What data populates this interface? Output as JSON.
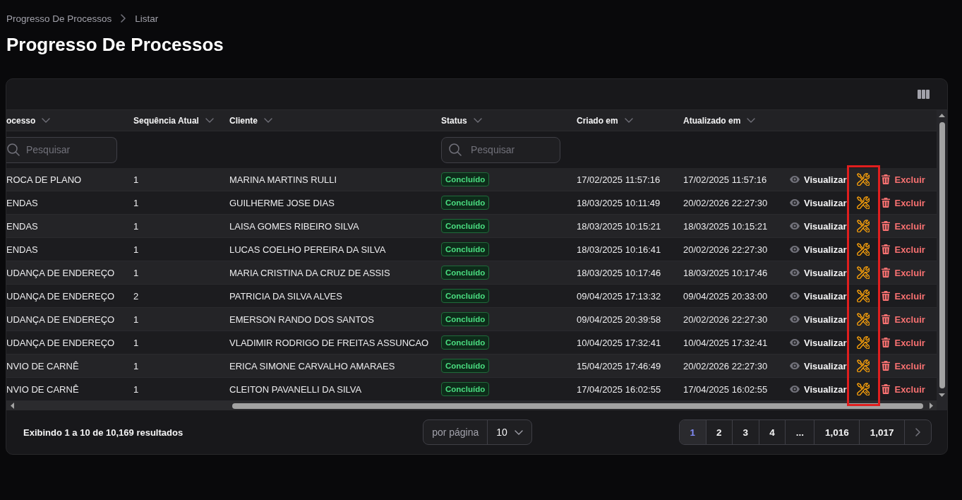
{
  "breadcrumb": [
    {
      "label": "Progresso De Processos"
    },
    {
      "label": "Listar"
    }
  ],
  "page_title": "Progresso De Processos",
  "table": {
    "columns": [
      {
        "label": "ocesso",
        "kind": "text",
        "filter": {
          "placeholder": "Pesquisar"
        }
      },
      {
        "label": "Sequência Atual",
        "kind": "text"
      },
      {
        "label": "Cliente",
        "kind": "text"
      },
      {
        "label": "Status",
        "kind": "badge",
        "filter": {
          "placeholder": "Pesquisar"
        }
      },
      {
        "label": "Criado em",
        "kind": "text"
      },
      {
        "label": "Atualizado em",
        "kind": "text"
      }
    ],
    "rows": [
      {
        "cells": [
          "ROCA DE PLANO",
          "1",
          "MARINA MARTINS RULLI",
          "Concluído",
          "17/02/2025 11:57:16",
          "17/02/2025 11:57:16"
        ],
        "actions": [
          {
            "kind": "view",
            "label": "Visualizar"
          },
          {
            "kind": "edit"
          },
          {
            "kind": "delete",
            "label": "Excluir"
          }
        ]
      },
      {
        "cells": [
          "ENDAS",
          "1",
          "GUILHERME JOSE DIAS",
          "Concluído",
          "18/03/2025 10:11:49",
          "20/02/2026 22:27:30"
        ],
        "actions": [
          {
            "kind": "view",
            "label": "Visualizar"
          },
          {
            "kind": "edit"
          },
          {
            "kind": "delete",
            "label": "Excluir"
          }
        ]
      },
      {
        "cells": [
          "ENDAS",
          "1",
          "LAISA GOMES RIBEIRO SILVA",
          "Concluído",
          "18/03/2025 10:15:21",
          "18/03/2025 10:15:21"
        ],
        "actions": [
          {
            "kind": "view",
            "label": "Visualizar"
          },
          {
            "kind": "edit"
          },
          {
            "kind": "delete",
            "label": "Excluir"
          }
        ]
      },
      {
        "cells": [
          "ENDAS",
          "1",
          "LUCAS COELHO PEREIRA DA SILVA",
          "Concluído",
          "18/03/2025 10:16:41",
          "20/02/2026 22:27:30"
        ],
        "actions": [
          {
            "kind": "view",
            "label": "Visualizar"
          },
          {
            "kind": "edit"
          },
          {
            "kind": "delete",
            "label": "Excluir"
          }
        ]
      },
      {
        "cells": [
          "UDANÇA DE ENDEREÇO",
          "1",
          "MARIA CRISTINA DA CRUZ DE ASSIS",
          "Concluído",
          "18/03/2025 10:17:46",
          "18/03/2025 10:17:46"
        ],
        "actions": [
          {
            "kind": "view",
            "label": "Visualizar"
          },
          {
            "kind": "edit"
          },
          {
            "kind": "delete",
            "label": "Excluir"
          }
        ]
      },
      {
        "cells": [
          "UDANÇA DE ENDEREÇO",
          "2",
          "PATRICIA DA SILVA ALVES",
          "Concluído",
          "09/04/2025 17:13:32",
          "09/04/2025 20:33:00"
        ],
        "actions": [
          {
            "kind": "view",
            "label": "Visualizar"
          },
          {
            "kind": "edit"
          },
          {
            "kind": "delete",
            "label": "Excluir"
          }
        ]
      },
      {
        "cells": [
          "UDANÇA DE ENDEREÇO",
          "1",
          "EMERSON RANDO DOS SANTOS",
          "Concluído",
          "09/04/2025 20:39:58",
          "20/02/2026 22:27:30"
        ],
        "actions": [
          {
            "kind": "view",
            "label": "Visualizar"
          },
          {
            "kind": "edit"
          },
          {
            "kind": "delete",
            "label": "Excluir"
          }
        ]
      },
      {
        "cells": [
          "UDANÇA DE ENDEREÇO",
          "1",
          "VLADIMIR RODRIGO DE FREITAS ASSUNCAO",
          "Concluído",
          "10/04/2025 17:32:41",
          "10/04/2025 17:32:41"
        ],
        "actions": [
          {
            "kind": "view",
            "label": "Visualizar"
          },
          {
            "kind": "edit"
          },
          {
            "kind": "delete",
            "label": "Excluir"
          }
        ]
      },
      {
        "cells": [
          "NVIO DE CARNÊ",
          "1",
          "ERICA SIMONE CARVALHO AMARAES",
          "Concluído",
          "15/04/2025 17:46:49",
          "20/02/2026 22:27:30"
        ],
        "actions": [
          {
            "kind": "view",
            "label": "Visualizar"
          },
          {
            "kind": "edit"
          },
          {
            "kind": "delete",
            "label": "Excluir"
          }
        ]
      },
      {
        "cells": [
          "NVIO DE CARNÊ",
          "1",
          "CLEITON PAVANELLI DA SILVA",
          "Concluído",
          "17/04/2025 16:02:55",
          "17/04/2025 16:02:55"
        ],
        "actions": [
          {
            "kind": "view",
            "label": "Visualizar"
          },
          {
            "kind": "edit"
          },
          {
            "kind": "delete",
            "label": "Excluir"
          }
        ]
      }
    ]
  },
  "annotation": {
    "kind": "box"
  },
  "footer": {
    "summary": "Exibindo 1 a 10 de 10,169 resultados",
    "per_page": {
      "label": "por página",
      "value": "10"
    },
    "pages": [
      {
        "label": "1",
        "selected": true
      },
      {
        "label": "2",
        "selected": false
      },
      {
        "label": "3",
        "selected": false
      },
      {
        "label": "4",
        "selected": false
      },
      {
        "label": "...",
        "selected": false
      },
      {
        "label": "1,016",
        "selected": false
      },
      {
        "label": "1,017",
        "selected": false
      }
    ]
  }
}
